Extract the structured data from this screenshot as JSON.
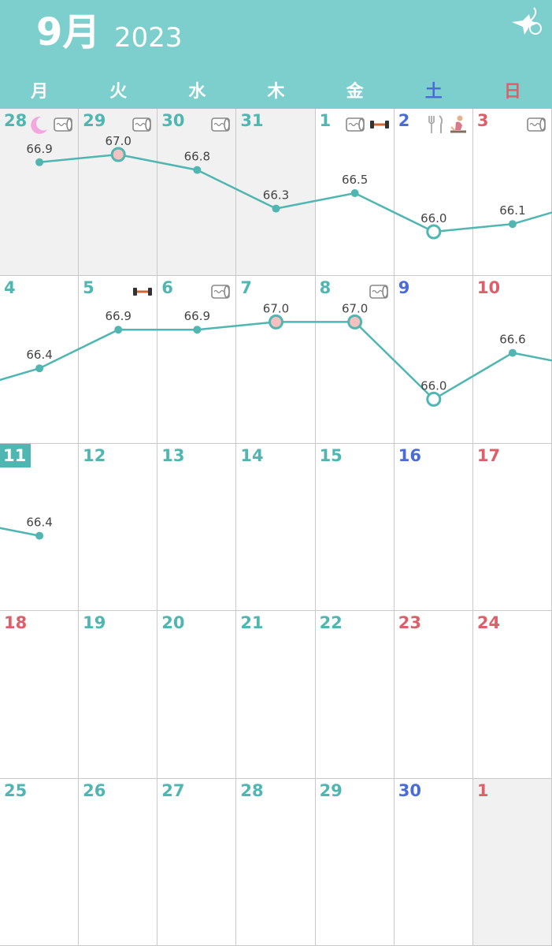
{
  "header": {
    "month": "9月",
    "year": "2023",
    "colors": {
      "bar": "#7ccfcc",
      "teal": "#4fb6b1",
      "saturday": "#4a6cd6",
      "sunday": "#dd5f69",
      "off_month": "#f1f1f1"
    }
  },
  "weekdays": [
    "月",
    "火",
    "水",
    "木",
    "金",
    "土",
    "日"
  ],
  "weeks": [
    [
      {
        "day": "28",
        "other": true,
        "icons": [
          "moon-icon",
          "toilet-roll-icon"
        ],
        "weight": "66.9",
        "mark": "dot"
      },
      {
        "day": "29",
        "other": true,
        "icons": [
          "toilet-roll-icon"
        ],
        "weight": "67.0",
        "mark": "pink"
      },
      {
        "day": "30",
        "other": true,
        "icons": [
          "toilet-roll-icon"
        ],
        "weight": "66.8",
        "mark": "dot"
      },
      {
        "day": "31",
        "other": true,
        "icons": [],
        "weight": "66.3",
        "mark": "dot"
      },
      {
        "day": "1",
        "icons": [
          "toilet-roll-icon",
          "dumbbell-icon"
        ],
        "weight": "66.5",
        "mark": "dot"
      },
      {
        "day": "2",
        "icons": [
          "fork-knife-icon",
          "yoga-icon"
        ],
        "weight": "66.0",
        "mark": "ring"
      },
      {
        "day": "3",
        "icons": [
          "toilet-roll-icon"
        ],
        "weight": "66.1",
        "mark": "dot"
      }
    ],
    [
      {
        "day": "4",
        "icons": [],
        "weight": "66.4",
        "mark": "dot"
      },
      {
        "day": "5",
        "icons": [
          "dumbbell-icon"
        ],
        "weight": "66.9",
        "mark": "dot"
      },
      {
        "day": "6",
        "icons": [
          "toilet-roll-icon"
        ],
        "weight": "66.9",
        "mark": "dot"
      },
      {
        "day": "7",
        "icons": [],
        "weight": "67.0",
        "mark": "pink"
      },
      {
        "day": "8",
        "icons": [
          "toilet-roll-icon"
        ],
        "weight": "67.0",
        "mark": "pink"
      },
      {
        "day": "9",
        "icons": [],
        "weight": "66.0",
        "mark": "ring"
      },
      {
        "day": "10",
        "icons": [],
        "weight": "66.6",
        "mark": "dot"
      }
    ],
    [
      {
        "day": "11",
        "today": true,
        "icons": [],
        "weight": "66.4",
        "mark": "dot"
      },
      {
        "day": "12",
        "icons": []
      },
      {
        "day": "13",
        "icons": []
      },
      {
        "day": "14",
        "icons": []
      },
      {
        "day": "15",
        "icons": []
      },
      {
        "day": "16",
        "icons": []
      },
      {
        "day": "17",
        "icons": []
      }
    ],
    [
      {
        "day": "18",
        "icons": [],
        "holiday": true
      },
      {
        "day": "19",
        "icons": []
      },
      {
        "day": "20",
        "icons": []
      },
      {
        "day": "21",
        "icons": []
      },
      {
        "day": "22",
        "icons": []
      },
      {
        "day": "23",
        "icons": [],
        "holiday": true
      },
      {
        "day": "24",
        "icons": []
      }
    ],
    [
      {
        "day": "25",
        "icons": []
      },
      {
        "day": "26",
        "icons": []
      },
      {
        "day": "27",
        "icons": []
      },
      {
        "day": "28",
        "icons": []
      },
      {
        "day": "29",
        "icons": []
      },
      {
        "day": "30",
        "icons": []
      },
      {
        "day": "1",
        "other": true,
        "icons": []
      }
    ]
  ]
}
